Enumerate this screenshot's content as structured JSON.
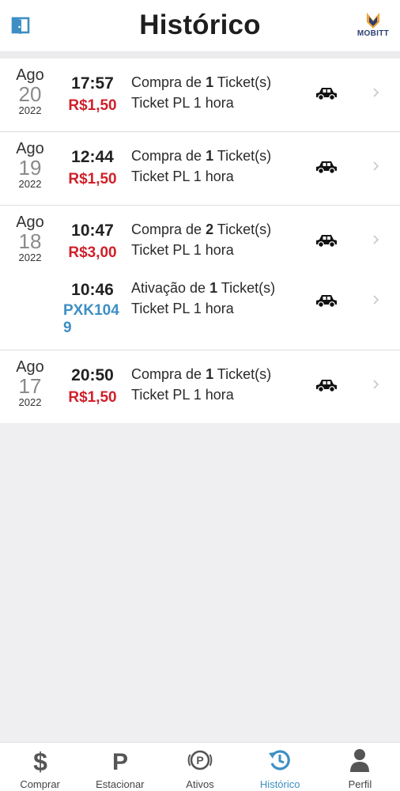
{
  "header": {
    "title": "Histórico",
    "exit_icon": "door-exit-icon",
    "logo_text": "MOBITT"
  },
  "colors": {
    "price_red": "#d0202a",
    "plate_blue": "#3d8fc4",
    "active_tab_blue": "#3d8fc4",
    "logo_orange": "#f0a030",
    "logo_navy": "#2c3f70"
  },
  "history": [
    {
      "date": {
        "month": "Ago",
        "day": "20",
        "year": "2022"
      },
      "entries": [
        {
          "time": "17:57",
          "amount": "R$1,50",
          "action": "Compra de",
          "qty": "1",
          "unit": "Ticket(s)",
          "product": "Ticket PL 1 hora",
          "icon": "car-icon"
        }
      ]
    },
    {
      "date": {
        "month": "Ago",
        "day": "19",
        "year": "2022"
      },
      "entries": [
        {
          "time": "12:44",
          "amount": "R$1,50",
          "action": "Compra de",
          "qty": "1",
          "unit": "Ticket(s)",
          "product": "Ticket PL 1 hora",
          "icon": "car-icon"
        }
      ]
    },
    {
      "date": {
        "month": "Ago",
        "day": "18",
        "year": "2022"
      },
      "entries": [
        {
          "time": "10:47",
          "amount": "R$3,00",
          "action": "Compra de",
          "qty": "2",
          "unit": "Ticket(s)",
          "product": "Ticket PL 1 hora",
          "icon": "car-icon"
        },
        {
          "time": "10:46",
          "plate": "PXK1049",
          "action": "Ativação de",
          "qty": "1",
          "unit": "Ticket(s)",
          "product": "Ticket PL 1 hora",
          "icon": "car-icon"
        }
      ]
    },
    {
      "date": {
        "month": "Ago",
        "day": "17",
        "year": "2022"
      },
      "entries": [
        {
          "time": "20:50",
          "amount": "R$1,50",
          "action": "Compra de",
          "qty": "1",
          "unit": "Ticket(s)",
          "product": "Ticket PL 1 hora",
          "icon": "car-icon"
        }
      ]
    }
  ],
  "tabbar": {
    "items": [
      {
        "label": "Comprar",
        "icon": "dollar-icon",
        "active": false
      },
      {
        "label": "Estacionar",
        "icon": "parking-p-icon",
        "active": false
      },
      {
        "label": "Ativos",
        "icon": "parking-circle-icon",
        "active": false
      },
      {
        "label": "Histórico",
        "icon": "history-clock-icon",
        "active": true
      },
      {
        "label": "Perfil",
        "icon": "person-icon",
        "active": false
      }
    ]
  }
}
